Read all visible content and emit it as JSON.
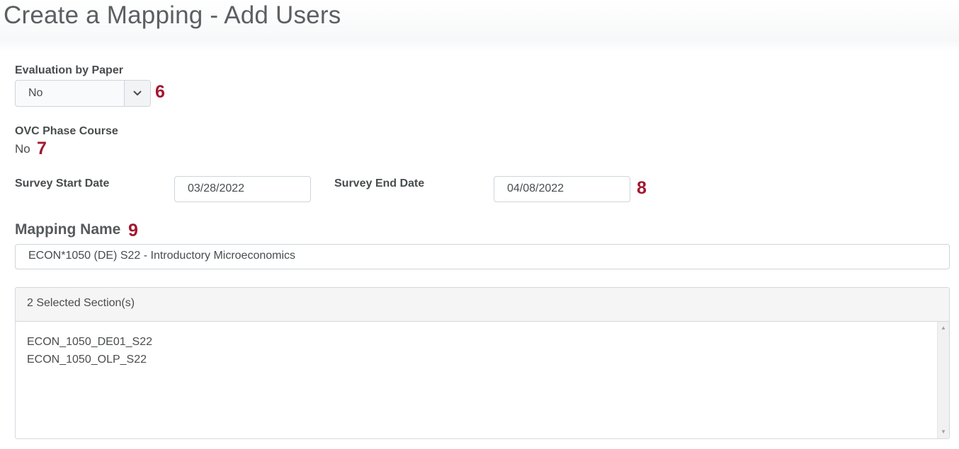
{
  "page": {
    "title": "Create a Mapping - Add Users"
  },
  "evaluation_by_paper": {
    "label": "Evaluation by Paper",
    "selected": "No",
    "callout": "6"
  },
  "ovc_phase_course": {
    "label": "OVC Phase Course",
    "value": "No",
    "callout": "7"
  },
  "survey_dates": {
    "start_label": "Survey Start Date",
    "start_value": "03/28/2022",
    "end_label": "Survey End Date",
    "end_value": "04/08/2022",
    "callout": "8"
  },
  "mapping_name": {
    "label": "Mapping Name",
    "value": "ECON*1050 (DE) S22 - Introductory Microeconomics",
    "callout": "9"
  },
  "sections": {
    "header": "2 Selected Section(s)",
    "items": [
      "ECON_1050_DE01_S22",
      "ECON_1050_OLP_S22"
    ]
  },
  "colors": {
    "callout": "#a3172f",
    "text": "#494c4e",
    "border": "#cdd5dc"
  },
  "icons": {
    "select_arrow": "chevron-down-icon",
    "scroll_up": "scroll-up-arrow-icon",
    "scroll_down": "scroll-down-arrow-icon"
  }
}
